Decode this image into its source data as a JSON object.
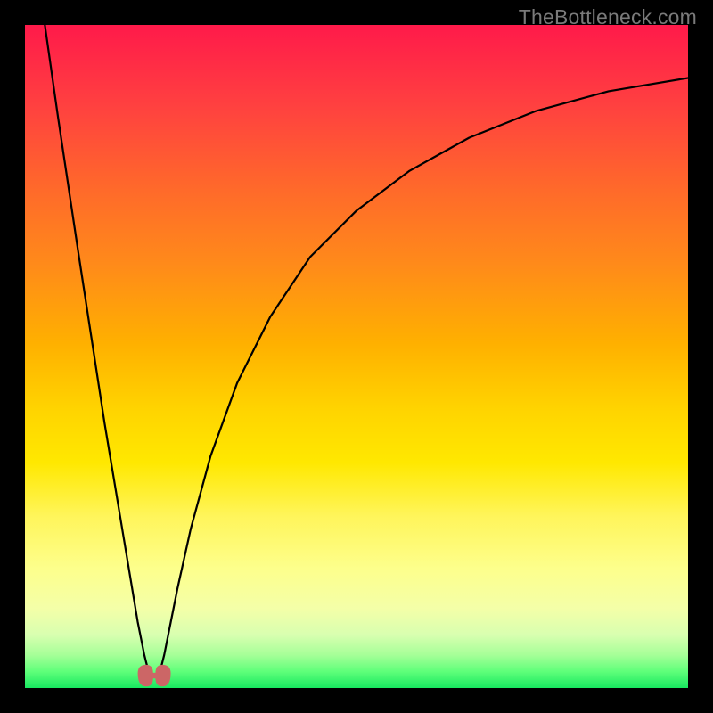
{
  "watermark": "TheBottleneck.com",
  "chart_data": {
    "type": "line",
    "title": "",
    "xlabel": "",
    "ylabel": "",
    "xlim": [
      0,
      100
    ],
    "ylim": [
      0,
      100
    ],
    "grid": false,
    "legend": false,
    "series": [
      {
        "name": "bottleneck-curve",
        "x": [
          3,
          5,
          8,
          10,
          12,
          14,
          15,
          16,
          17,
          18,
          18.5,
          19,
          19.5,
          20,
          20.5,
          21,
          22,
          23,
          25,
          28,
          32,
          37,
          43,
          50,
          58,
          67,
          77,
          88,
          100
        ],
        "y": [
          100,
          86,
          66,
          53,
          40,
          28,
          22,
          16,
          10,
          5,
          3,
          2,
          2,
          2,
          3,
          5,
          10,
          15,
          24,
          35,
          46,
          56,
          65,
          72,
          78,
          83,
          87,
          90,
          92
        ],
        "minimum_x": 19.5,
        "minimum_y": 2
      }
    ],
    "marker": {
      "name": "optimal-point",
      "x": 19.5,
      "y": 2,
      "color": "#cc6666"
    },
    "gradient_colors": {
      "top": "#ff1a4a",
      "bottom": "#18e860"
    }
  }
}
